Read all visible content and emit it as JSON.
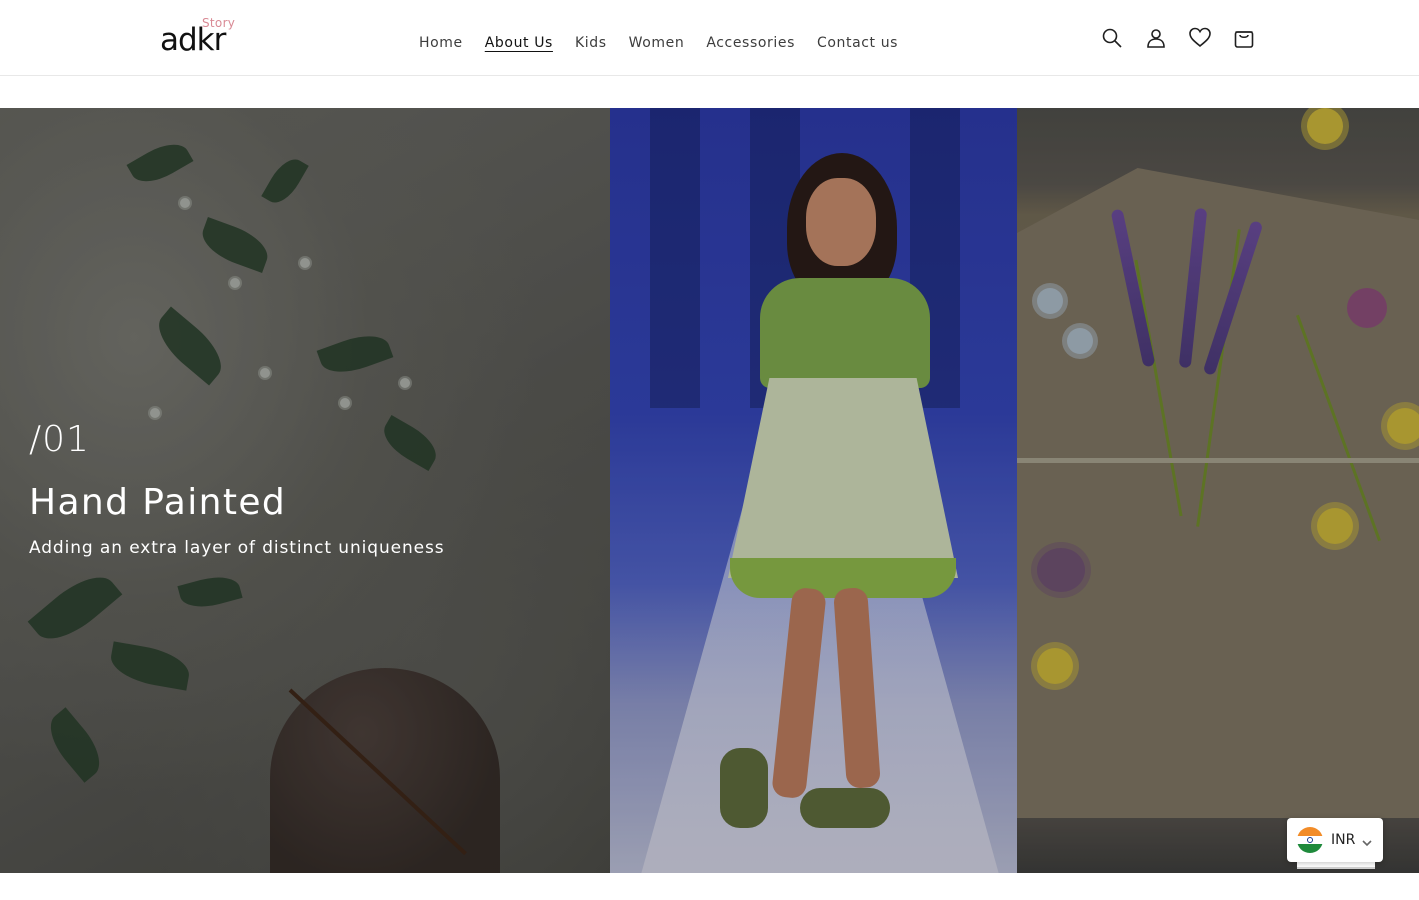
{
  "header": {
    "logo_small": "Story",
    "logo_main": "adkr",
    "nav": [
      {
        "label": "Home"
      },
      {
        "label": "About Us"
      },
      {
        "label": "Kids"
      },
      {
        "label": "Women"
      },
      {
        "label": "Accessories"
      },
      {
        "label": "Contact us"
      }
    ],
    "active_nav": "About Us",
    "icons": [
      "search-icon",
      "account-icon",
      "wishlist-heart-icon",
      "cart-bag-icon"
    ]
  },
  "hero": {
    "slide_number": "/01",
    "title": "Hand Painted",
    "subtitle": "Adding an extra layer of distinct uniqueness"
  },
  "currency": {
    "code": "INR",
    "flag": "india-flag-icon"
  },
  "colors": {
    "text": "#121212",
    "nav_text": "#3d3d3d",
    "logo_accent": "#d98a95",
    "hero_text": "#ffffff"
  }
}
